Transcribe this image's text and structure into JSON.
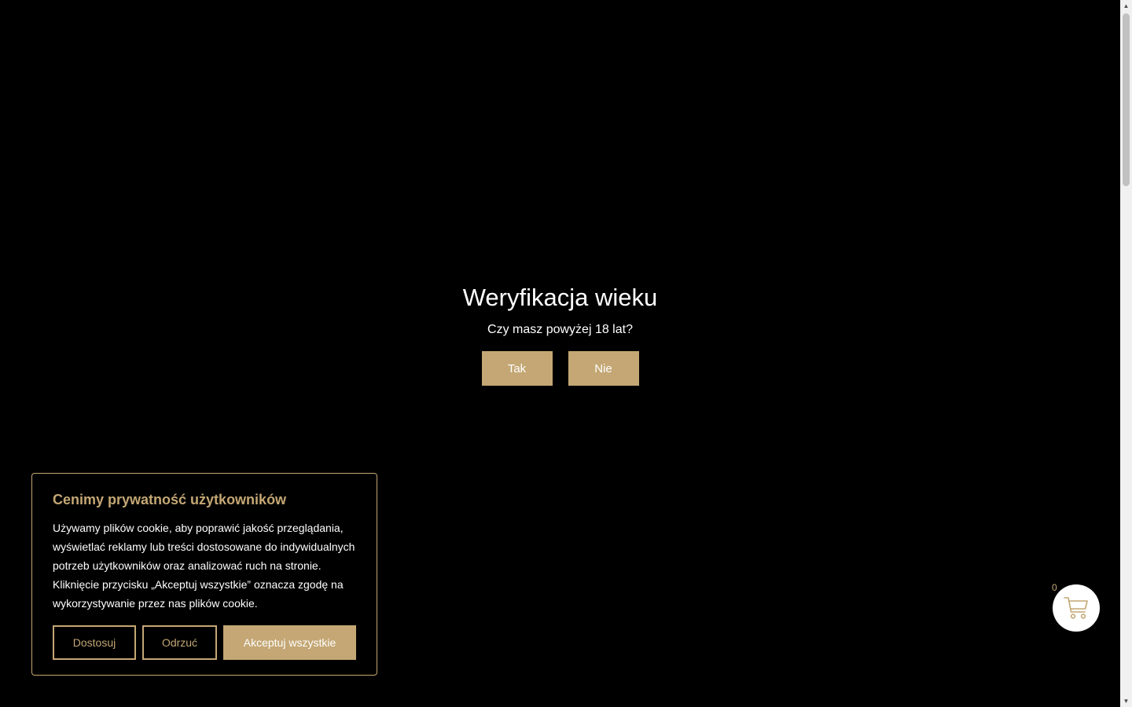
{
  "age_gate": {
    "title": "Weryfikacja wieku",
    "question": "Czy masz powyżej 18 lat?",
    "yes_label": "Tak",
    "no_label": "Nie"
  },
  "cookie_banner": {
    "title": "Cenimy prywatność użytkowników",
    "text": "Używamy plików cookie, aby poprawić jakość przeglądania, wyświetlać reklamy lub treści dostosowane do indywidualnych potrzeb użytkowników oraz analizować ruch na stronie. Kliknięcie przycisku „Akceptuj wszystkie” oznacza zgodę na wykorzystywanie przez nas plików cookie.",
    "customize_label": "Dostosuj",
    "reject_label": "Odrzuć",
    "accept_label": "Akceptuj wszystkie"
  },
  "cart": {
    "count": "0",
    "icon": "cart-icon"
  },
  "colors": {
    "accent": "#c4a774",
    "background": "#000000"
  }
}
